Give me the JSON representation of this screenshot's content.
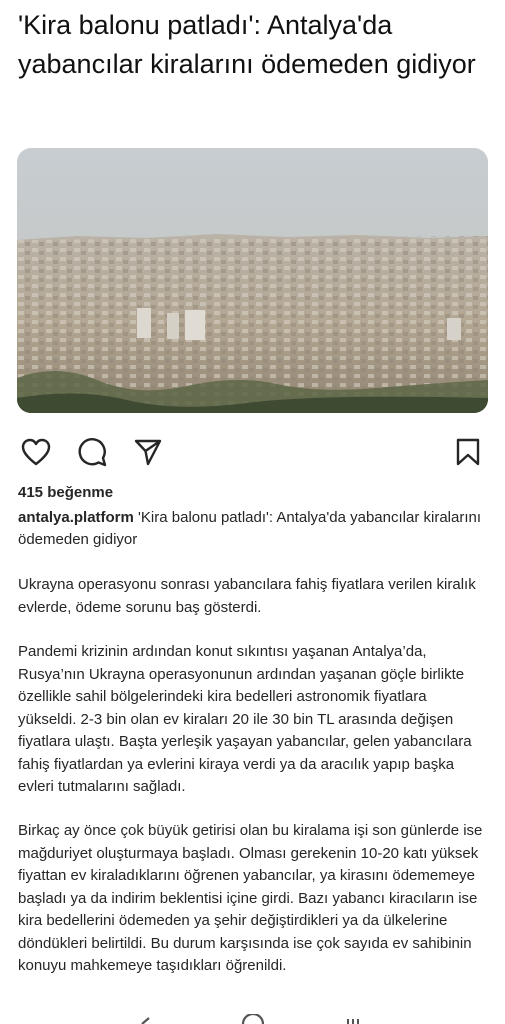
{
  "post": {
    "headline": "'Kira balonu patladı': Antalya'da yabancılar kiralarını ödemeden gidiyor",
    "likes": "415 beğenme",
    "username": "antalya.platform",
    "caption": "'Kira balonu patladı': Antalya'da yabancılar kiralarını ödemeden gidiyor",
    "paragraphs": [
      "Ukrayna operasyonu sonrası yabancılara fahiş fiyatlara verilen kiralık evlerde, ödeme sorunu baş gösterdi.",
      "Pandemi krizinin ardından konut sıkıntısı yaşanan Antalya’da, Rusya’nın Ukrayna operasyonunun ardından yaşanan göçle birlikte özellikle sahil bölgelerindeki kira bedelleri astronomik fiyatlara yükseldi. 2-3 bin olan ev kiraları 20 ile 30 bin TL arasında değişen fiyatlara ulaştı. Başta yerleşik yaşayan yabancılar, gelen yabancılara fahiş fiyatlardan ya evlerini kiraya verdi ya da aracılık yapıp başka evleri tutmalarını sağladı.",
      "Birkaç ay önce çok büyük getirisi olan bu kiralama işi son günlerde ise mağduriyet oluşturmaya başladı. Olması gerekenin 10-20 katı yüksek fiyattan ev kiraladıklarını öğrenen yabancılar, ya kirasını ödememeye başladı ya da indirim beklentisi içine girdi. Bazı yabancı kiracıların ise kira bedellerini ödemeden ya şehir değiştirdikleri ya da ülkelerine döndükleri belirtildi. Bu durum karşısında ise çok sayıda ev sahibinin konuyu mahkemeye taşıdıkları öğrenildi."
    ]
  },
  "icons": {
    "like": "heart-icon",
    "comment": "comment-icon",
    "share": "send-icon",
    "save": "bookmark-icon",
    "back": "back-icon",
    "home": "home-icon",
    "recents": "recents-icon"
  },
  "colors": {
    "text": "#262626",
    "sky": "#c9cfd3",
    "city": "#b7ab98"
  }
}
